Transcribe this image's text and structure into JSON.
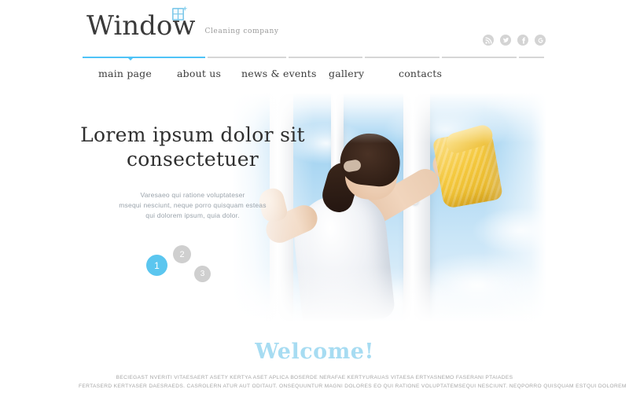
{
  "header": {
    "logo": {
      "word": "Window",
      "tagline": "Cleaning company",
      "icon": "window-panes-sparkle-icon"
    },
    "social": [
      {
        "name": "rss-icon",
        "label": "RSS"
      },
      {
        "name": "twitter-icon",
        "label": "Twitter"
      },
      {
        "name": "facebook-icon",
        "label": "Facebook"
      },
      {
        "name": "google-plus-icon",
        "label": "Google Plus"
      }
    ]
  },
  "nav": {
    "items": [
      {
        "label": "main page",
        "active": true
      },
      {
        "label": "about us",
        "active": false
      },
      {
        "label": "news & events",
        "active": false
      },
      {
        "label": "gallery",
        "active": false
      },
      {
        "label": "contacts",
        "active": false
      }
    ]
  },
  "hero": {
    "title_line1": "Lorem ipsum dolor sit",
    "title_line2": "consectetuer",
    "description_line1": "Varesaeo qui ratione voluptateser",
    "description_line2": "msequi nesciunt, neque porro quisquam esteas",
    "description_line3": "qui dolorem ipsum, quia dolor.",
    "image_alt": "woman-cleaning-window-with-yellow-cloth",
    "bullets": [
      {
        "label": "1",
        "active": true
      },
      {
        "label": "2",
        "active": false
      },
      {
        "label": "3",
        "active": false
      }
    ]
  },
  "welcome": {
    "heading": "Welcome!",
    "paragraph_line1": "BECIEGAST NVERITI VITAESAERT ASETY KERTYA ASET APLICA BOSERDE NERAFAE KERTYURAUAS VITAESA ERTYASNEMO FASERANI PTAIADES",
    "paragraph_line2": "FERTASERD KERTYASER DAESRAEDS. CASROLERN ATUR AUT ODITAUT. ONSEQUUNTUR MAGNI DOLORES EO QUI RATIONE VOLUPTATEMSEQUI NESCIUNT. NEQPORRO QUISQUAM ESTQUI DOLOREM"
  },
  "colors": {
    "accent_blue": "#4fc3f7",
    "bullet_active": "#5bc6ef",
    "bullet_inactive": "#cfcfcf",
    "welcome_blue": "#a7dcf2",
    "nav_text": "#3c3c3c",
    "rule_gray": "#d6d6d6",
    "body_text_gray": "#a6a6a6",
    "page_background": "#ffffff"
  }
}
